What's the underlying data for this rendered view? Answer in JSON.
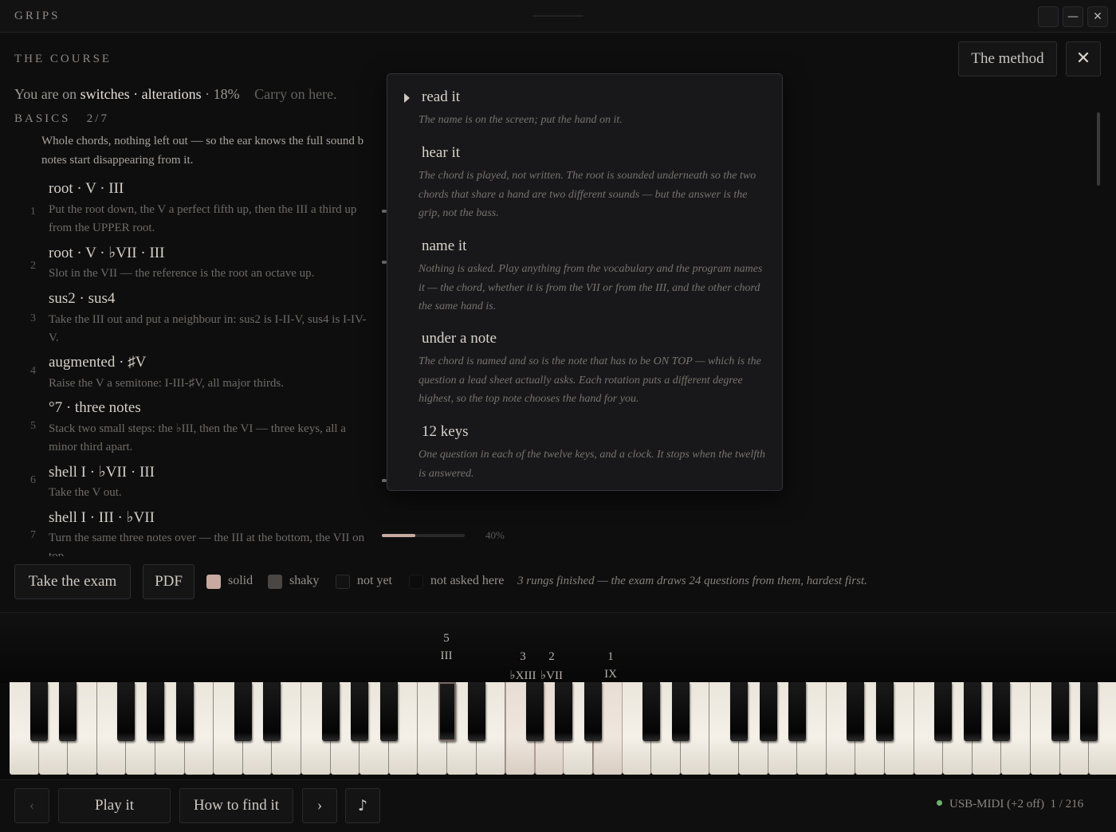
{
  "window": {
    "title": "GRIPS"
  },
  "header": {
    "section_title": "THE COURSE",
    "method_label": "The method",
    "close_glyph": "✕"
  },
  "progress": {
    "prefix": "You are on",
    "rung": "switches · alterations",
    "percent": "· 18%",
    "carry_on": "Carry on here."
  },
  "basics": {
    "heading": "BASICS",
    "count": "2/7",
    "description": "Whole chords, nothing left out — so the ear knows the full sound b",
    "description2": "notes start disappearing from it."
  },
  "rungs": [
    {
      "num": "1",
      "title": "root · V · III",
      "desc": "Put the root down, the V a perfect fifth up, then the III a third up from the UPPER root."
    },
    {
      "num": "2",
      "title": "root · V · ♭VII · III",
      "desc": "Slot in the VII — the reference is the root an octave up."
    },
    {
      "num": "3",
      "title": "sus2 · sus4",
      "desc": "Take the III out and put a neighbour in: sus2 is I-II-V, sus4 is I-IV-V."
    },
    {
      "num": "4",
      "title": "augmented · ♯V",
      "desc": "Raise the V a semitone: I-III-♯V, all major thirds."
    },
    {
      "num": "5",
      "title": "°7 · three notes",
      "desc": "Stack two small steps: the ♭III, then the VI — three keys, all a minor third apart."
    },
    {
      "num": "6",
      "title": "shell I · ♭VII · III",
      "desc": "Take the V out."
    },
    {
      "num": "7",
      "title": "shell I · III · ♭VII",
      "desc": "Turn the same three notes over — the III at the bottom, the VII on top.",
      "progress": 0.4,
      "pct_label": "40%"
    }
  ],
  "modes": [
    {
      "title": "read it",
      "desc": "The name is on the screen; put the hand on it.",
      "selected": true
    },
    {
      "title": "hear it",
      "desc": "The chord is played, not written. The root is sounded underneath so the two chords that share a hand are two different sounds — but the answer is the grip, not the bass."
    },
    {
      "title": "name it",
      "desc": "Nothing is asked. Play anything from the vocabulary and the program names it — the chord, whether it is from the VII or from the III, and the other chord the same hand is."
    },
    {
      "title": "under a note",
      "desc": "The chord is named and so is the note that has to be ON TOP — which is the question a lead sheet actually asks. Each rotation puts a different degree highest, so the top note chooses the hand for you."
    },
    {
      "title": "12 keys",
      "desc": "One question in each of the twelve keys, and a clock. It stops when the twelfth is answered."
    }
  ],
  "actions": {
    "exam_label": "Take the exam",
    "pdf_label": "PDF",
    "legend": [
      {
        "label": "solid",
        "color": "#c9aaa0"
      },
      {
        "label": "shaky",
        "color": "#4a4644"
      },
      {
        "label": "not yet",
        "color": "#121213"
      },
      {
        "label": "not asked here",
        "color": "#0c0c0d"
      }
    ],
    "exam_note": "3 rungs finished — the exam draws 24 questions from them, hardest first."
  },
  "keyboard": {
    "labels": [
      {
        "finger": "5",
        "degree": "III"
      },
      {
        "finger": "3",
        "degree": "♭XIII"
      },
      {
        "finger": "2",
        "degree": "♭VII"
      },
      {
        "finger": "1",
        "degree": "IX"
      }
    ]
  },
  "footer": {
    "prev_glyph": "‹",
    "play_label": "Play it",
    "find_label": "How to find it",
    "next_glyph": "›",
    "note_glyph": "♪",
    "midi_label": "USB-MIDI (+2 off)",
    "counter": "1  /  216"
  }
}
